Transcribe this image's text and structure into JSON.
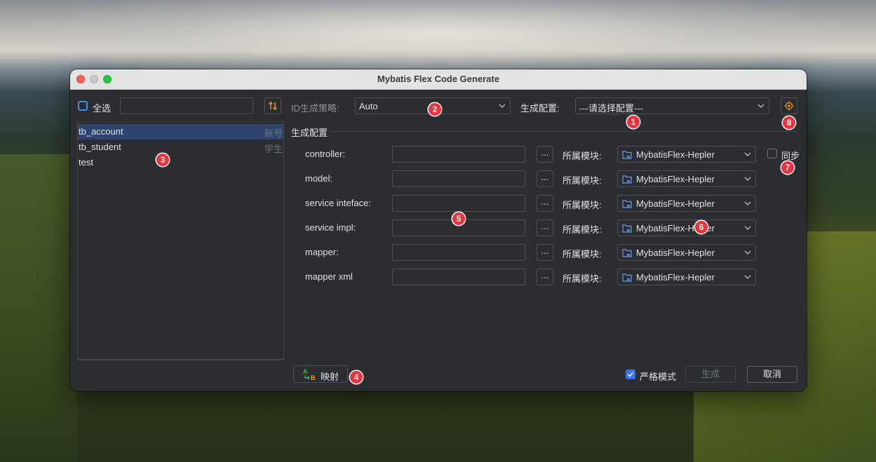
{
  "window": {
    "title": "Mybatis Flex Code Generate"
  },
  "left_panel": {
    "select_all_label": "全选",
    "search_value": "",
    "tables": [
      {
        "name": "tb_account",
        "comment": "账号",
        "selected": true
      },
      {
        "name": "tb_student",
        "comment": "学生",
        "selected": false
      },
      {
        "name": "test",
        "comment": "",
        "selected": false
      }
    ]
  },
  "top_bar": {
    "id_strategy_label": "ID生成策略:",
    "id_strategy_value": "Auto",
    "gen_config_label": "生成配置:",
    "gen_config_value": "---请选择配置---"
  },
  "section": {
    "title": "生成配置"
  },
  "module_label": "所属模块:",
  "dots_label": "...",
  "rows": [
    {
      "label": "controller:",
      "path": "",
      "module": "MybatisFlex-Hepler"
    },
    {
      "label": "model:",
      "path": "",
      "module": "MybatisFlex-Hepler"
    },
    {
      "label": "service inteface:",
      "path": "",
      "module": "MybatisFlex-Hepler"
    },
    {
      "label": "service impl:",
      "path": "",
      "module": "MybatisFlex-Hepler"
    },
    {
      "label": "mapper:",
      "path": "",
      "module": "MybatisFlex-Hepler"
    },
    {
      "label": "mapper xml",
      "path": "",
      "module": "MybatisFlex-Hepler"
    }
  ],
  "sync": {
    "label": "同步",
    "checked": false
  },
  "bottom": {
    "map_button_label": "映射",
    "strict_mode_label": "严格模式",
    "strict_mode_checked": true,
    "generate_label": "生成",
    "cancel_label": "取消"
  },
  "callouts": [
    "1",
    "2",
    "3",
    "4",
    "5",
    "6",
    "7",
    "8"
  ],
  "colors": {
    "accent": "#3574f0",
    "callout": "#e8343f",
    "selection": "#2e436e",
    "window_bg": "#2b2d30"
  }
}
